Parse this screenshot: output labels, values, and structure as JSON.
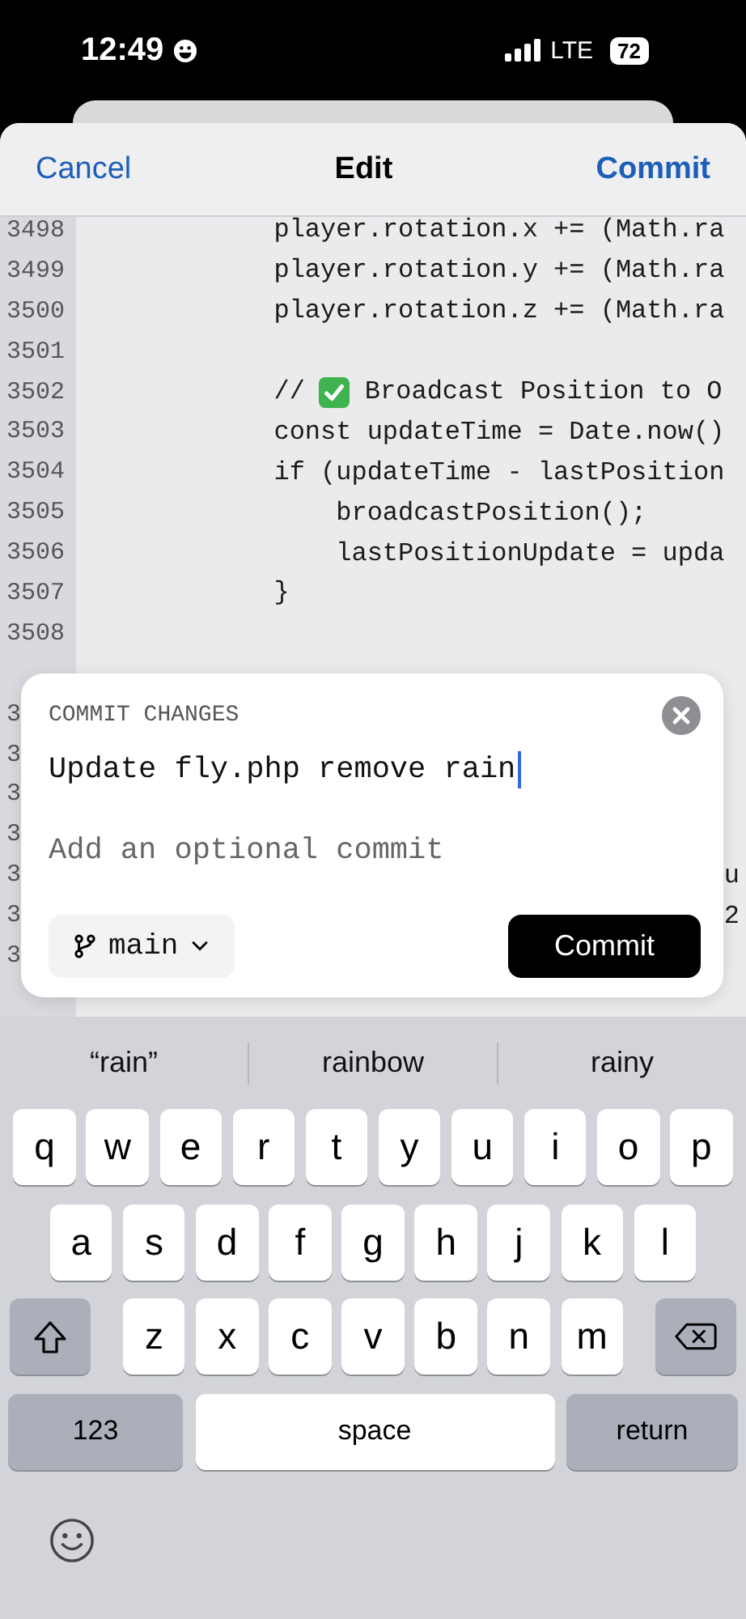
{
  "status_bar": {
    "time": "12:49",
    "network": "LTE",
    "battery": "72"
  },
  "nav": {
    "cancel": "Cancel",
    "title": "Edit",
    "commit": "Commit"
  },
  "code_lines": [
    {
      "kind": "code",
      "number": "3498",
      "segments": [
        {
          "kind": "text",
          "text": "            player.rotation.x += (Math.ra"
        }
      ]
    },
    {
      "kind": "code",
      "number": "3499",
      "segments": [
        {
          "kind": "text",
          "text": "            player.rotation.y += (Math.ra"
        }
      ]
    },
    {
      "kind": "code",
      "number": "3500",
      "segments": [
        {
          "kind": "text",
          "text": "            player.rotation.z += (Math.ra"
        }
      ]
    },
    {
      "kind": "code",
      "number": "3501"
    },
    {
      "kind": "code",
      "number": "3502",
      "segments": [
        {
          "kind": "text",
          "text": "            //"
        },
        {
          "kind": "check"
        },
        {
          "kind": "text",
          "text": "Broadcast Position to O"
        }
      ]
    },
    {
      "kind": "code",
      "number": "3503",
      "segments": [
        {
          "kind": "text",
          "text": "            const updateTime = Date.now()"
        }
      ]
    },
    {
      "kind": "code",
      "number": "3504",
      "segments": [
        {
          "kind": "text",
          "text": "            if (updateTime - lastPosition"
        }
      ]
    },
    {
      "kind": "code",
      "number": "3505",
      "segments": [
        {
          "kind": "text",
          "text": "                broadcastPosition();"
        }
      ]
    },
    {
      "kind": "code",
      "number": "3506",
      "segments": [
        {
          "kind": "text",
          "text": "                lastPositionUpdate = upda"
        }
      ]
    },
    {
      "kind": "code",
      "number": "3507",
      "segments": [
        {
          "kind": "text",
          "text": "            }"
        }
      ]
    },
    {
      "kind": "code",
      "number": "3508"
    },
    {
      "kind": "covered"
    },
    {
      "kind": "code",
      "number": "3"
    },
    {
      "kind": "code",
      "number": "3"
    },
    {
      "kind": "code",
      "number": "3"
    },
    {
      "kind": "code",
      "number": "3"
    },
    {
      "kind": "code",
      "number": "3",
      "segments": [
        {
          "kind": "tail",
          "text": "u"
        }
      ]
    },
    {
      "kind": "code",
      "number": "3",
      "segments": [
        {
          "kind": "tail",
          "text": "2"
        }
      ]
    },
    {
      "kind": "code",
      "number": "3"
    },
    {
      "kind": "covered"
    }
  ],
  "commit_dialog": {
    "title": "COMMIT CHANGES",
    "message": "Update fly.php remove rain",
    "description_placeholder": "Add an optional commit",
    "branch": "main",
    "commit_button": "Commit"
  },
  "keyboard": {
    "suggestions": [
      "“rain”",
      "rainbow",
      "rainy"
    ],
    "rows": [
      {
        "keys": [
          {
            "kind": "letter",
            "label": "q"
          },
          {
            "kind": "letter",
            "label": "w"
          },
          {
            "kind": "letter",
            "label": "e"
          },
          {
            "kind": "letter",
            "label": "r"
          },
          {
            "kind": "letter",
            "label": "t"
          },
          {
            "kind": "letter",
            "label": "y"
          },
          {
            "kind": "letter",
            "label": "u"
          },
          {
            "kind": "letter",
            "label": "i"
          },
          {
            "kind": "letter",
            "label": "o"
          },
          {
            "kind": "letter",
            "label": "p"
          }
        ]
      },
      {
        "keys": [
          {
            "kind": "letter",
            "label": "a"
          },
          {
            "kind": "letter",
            "label": "s"
          },
          {
            "kind": "letter",
            "label": "d"
          },
          {
            "kind": "letter",
            "label": "f"
          },
          {
            "kind": "letter",
            "label": "g"
          },
          {
            "kind": "letter",
            "label": "h"
          },
          {
            "kind": "letter",
            "label": "j"
          },
          {
            "kind": "letter",
            "label": "k"
          },
          {
            "kind": "letter",
            "label": "l"
          }
        ]
      },
      {
        "keys": [
          {
            "kind": "shift"
          },
          {
            "kind": "letter",
            "label": "z"
          },
          {
            "kind": "letter",
            "label": "x"
          },
          {
            "kind": "letter",
            "label": "c"
          },
          {
            "kind": "letter",
            "label": "v"
          },
          {
            "kind": "letter",
            "label": "b"
          },
          {
            "kind": "letter",
            "label": "n"
          },
          {
            "kind": "letter",
            "label": "m"
          },
          {
            "kind": "backspace"
          }
        ]
      },
      {
        "keys": [
          {
            "kind": "mode",
            "label": "123"
          },
          {
            "kind": "space",
            "label": "space"
          },
          {
            "kind": "return",
            "label": "return"
          }
        ]
      }
    ]
  }
}
